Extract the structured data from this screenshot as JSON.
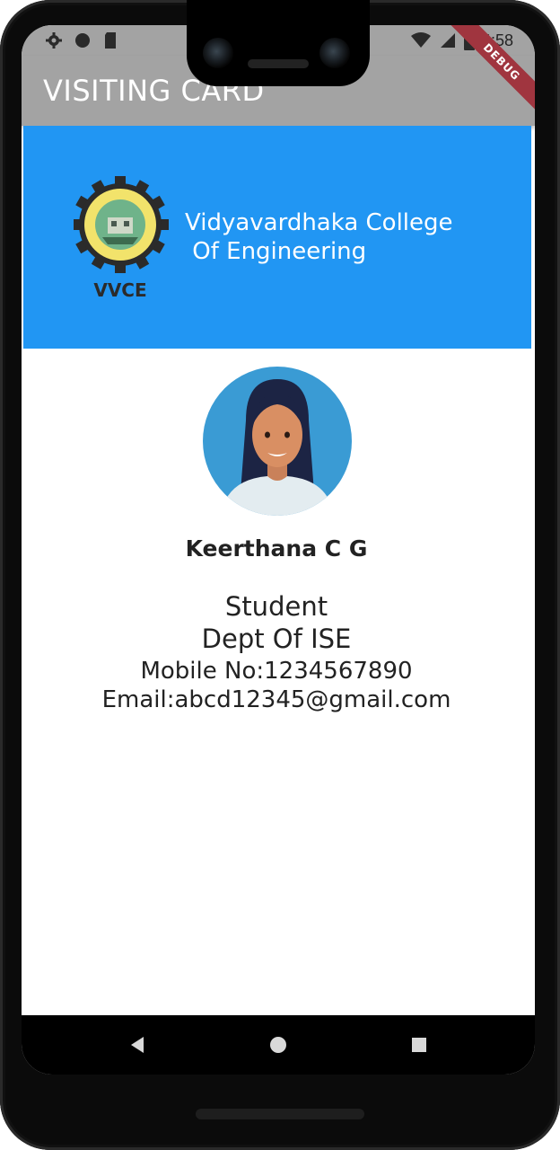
{
  "status_bar": {
    "time": "4:58",
    "icons": [
      "settings-icon",
      "circle-icon",
      "sd-card-icon",
      "wifi-icon",
      "signal-icon",
      "battery-icon"
    ]
  },
  "app_bar": {
    "title": "VISITING CARD",
    "debug_label": "DEBUG"
  },
  "colors": {
    "app_bar": "#a3a3a3",
    "header": "#2196f3",
    "text": "#222222",
    "debug": "#a0353f"
  },
  "college": {
    "name": "Vidyavardhaka College\n Of Engineering",
    "logo_text": "VVCE"
  },
  "profile": {
    "name": "Keerthana C G",
    "role": "Student",
    "dept": "Dept Of ISE",
    "mobile": "Mobile No:1234567890",
    "email": "Email:abcd12345@gmail.com"
  },
  "nav": {
    "buttons": [
      "back-icon",
      "home-icon",
      "recents-icon"
    ]
  }
}
